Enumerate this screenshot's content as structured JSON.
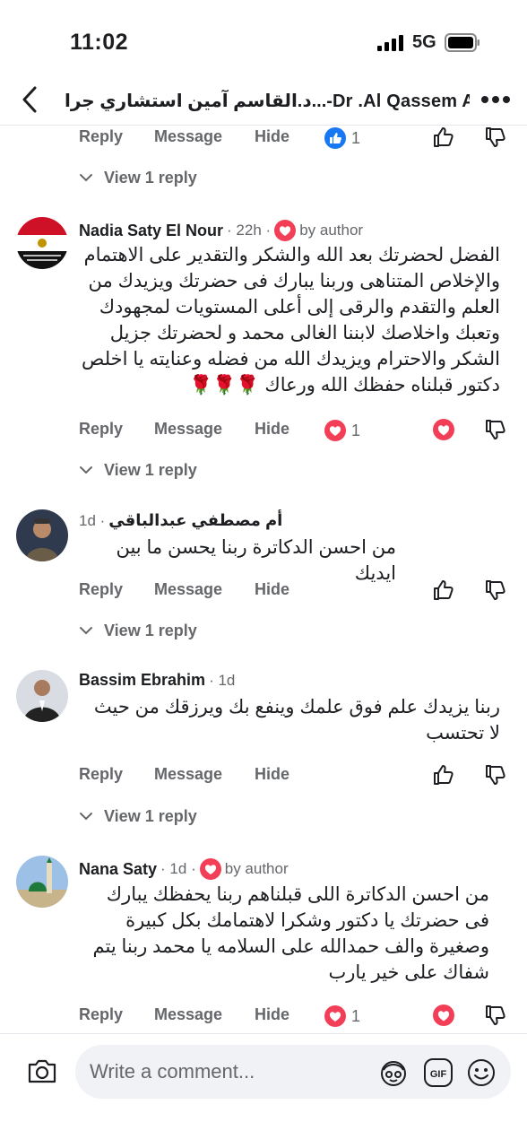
{
  "status_bar": {
    "time": "11:02",
    "network": "5G"
  },
  "header": {
    "title": "د.القاسم آمين استشاري جرا...-Dr .Al Qassem Amin"
  },
  "actions": {
    "reply": "Reply",
    "message": "Message",
    "hide": "Hide"
  },
  "view_reply_label": "View 1 reply",
  "top_partial": {
    "reaction_count": "1",
    "reaction_type": "like"
  },
  "comments": [
    {
      "name": "Nadia Saty El Nour",
      "time": " · 22h · ",
      "author_tag": "by author",
      "text": "الفضل لحضرتك بعد الله والشكر  والتقدير  على الاهتمام والإخلاص المتناهى وربنا يبارك فى حضرتك ويزيدك من العلم والتقدم والرقى إلى أعلى المستويات لمجهودك وتعبك واخلاصك لابننا الغالى محمد و لحضرتك جزيل الشكر والاحترام ويزيدك الله من فضله وعنايته يا اخلص دكتور قبلناه حفظك الله ورعاك",
      "emoji": "🌹🌹🌹",
      "reaction_count": "1"
    },
    {
      "name": "أم  مصطفي  عبدالباقي",
      "time": "1d · ",
      "text": "من احسن الدكاترة ربنا يحسن ما بين ايديك"
    },
    {
      "name": "Bassim Ebrahim",
      "time": " · 1d",
      "text": "ربنا يزيدك علم فوق علمك وينفع بك ويرزقك من حيث لا تحتسب"
    },
    {
      "name": "Nana Saty",
      "time": " · 1d · ",
      "author_tag": "by author",
      "text": "من احسن الدكاترة اللى قبلناهم  ربنا يحفظك يبارك فى حضرتك يا دكتور وشكرا لاهتمامك بكل كبيرة وصغيرة والف حمدالله على السلامه يا محمد ربنا يتم شفاك على خير يارب",
      "reaction_count": "1"
    }
  ],
  "composer": {
    "placeholder": "Write a comment..."
  },
  "colors": {
    "accent_blue": "#1877f2",
    "love_red": "#f33e58",
    "meta_gray": "#65676b"
  },
  "icons": [
    "back-icon",
    "more-icon",
    "like-icon",
    "love-icon",
    "thumb-up-icon",
    "thumb-down-icon",
    "chevron-down-icon",
    "camera-icon",
    "avatar-sticker-icon",
    "gif-icon",
    "emoji-icon"
  ]
}
